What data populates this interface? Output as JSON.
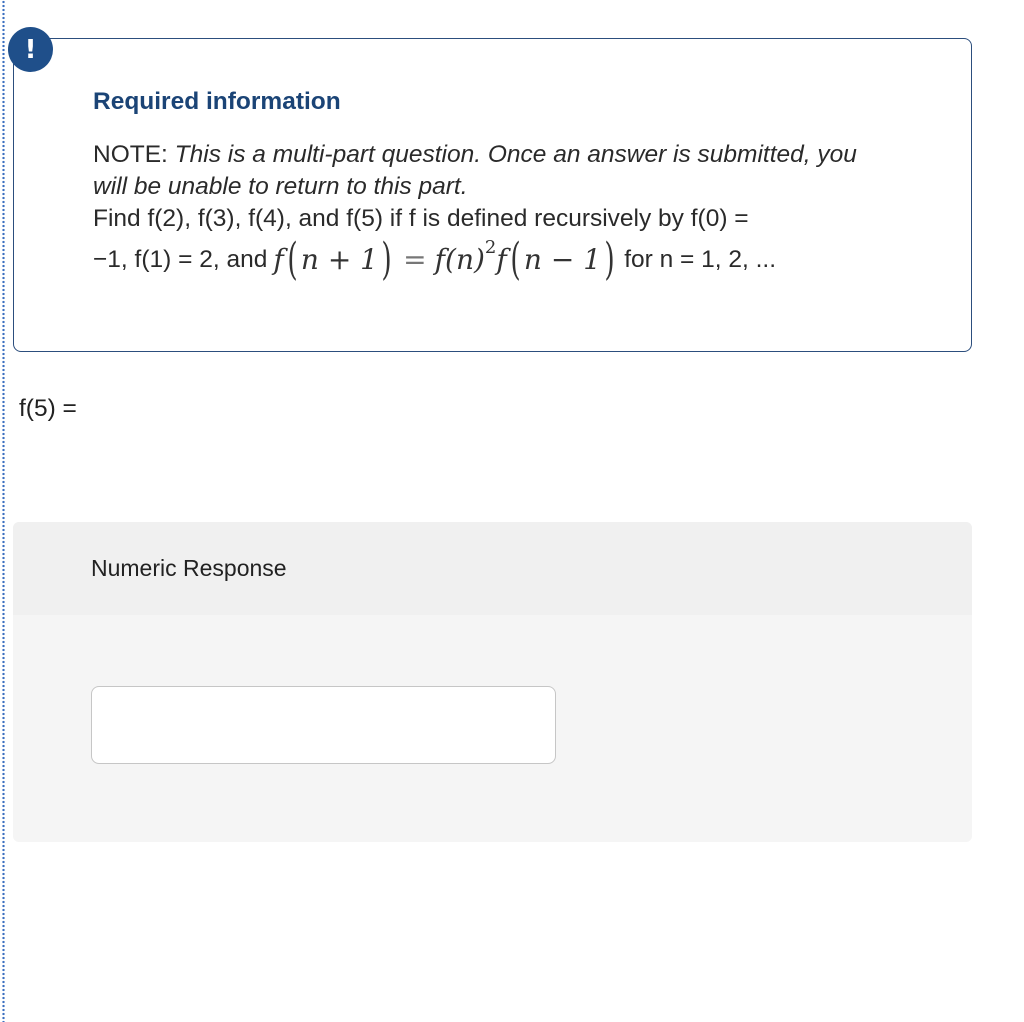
{
  "alert": {
    "icon": "exclamation-icon",
    "glyph": "!"
  },
  "card": {
    "title": "Required information",
    "note_prefix": "NOTE: ",
    "note_text": "This is a multi-part question. Once an answer is submitted, you will be unable to return to this part.",
    "find_text": "Find f(2), f(3), f(4), and f(5) if f is defined recursively by f(0) =",
    "init_text": "−1, f(1) = 2, and",
    "formula": {
      "lhs_f": "f",
      "lhs_arg": "n + 1",
      "equals": "=",
      "rhs_f1": "f",
      "rhs_arg1": "(n)",
      "exp": "2",
      "rhs_f2": "f",
      "rhs_arg2": "n − 1"
    },
    "domain_text": "for  n = 1, 2, ..."
  },
  "question": {
    "label": "f(5) ="
  },
  "response": {
    "title": "Numeric Response",
    "input_value": "",
    "input_placeholder": ""
  },
  "colors": {
    "accent": "#1f4f8a",
    "title": "#1b4476",
    "panel_bg": "#f5f5f5",
    "panel_header_bg": "#f0f0f0"
  }
}
